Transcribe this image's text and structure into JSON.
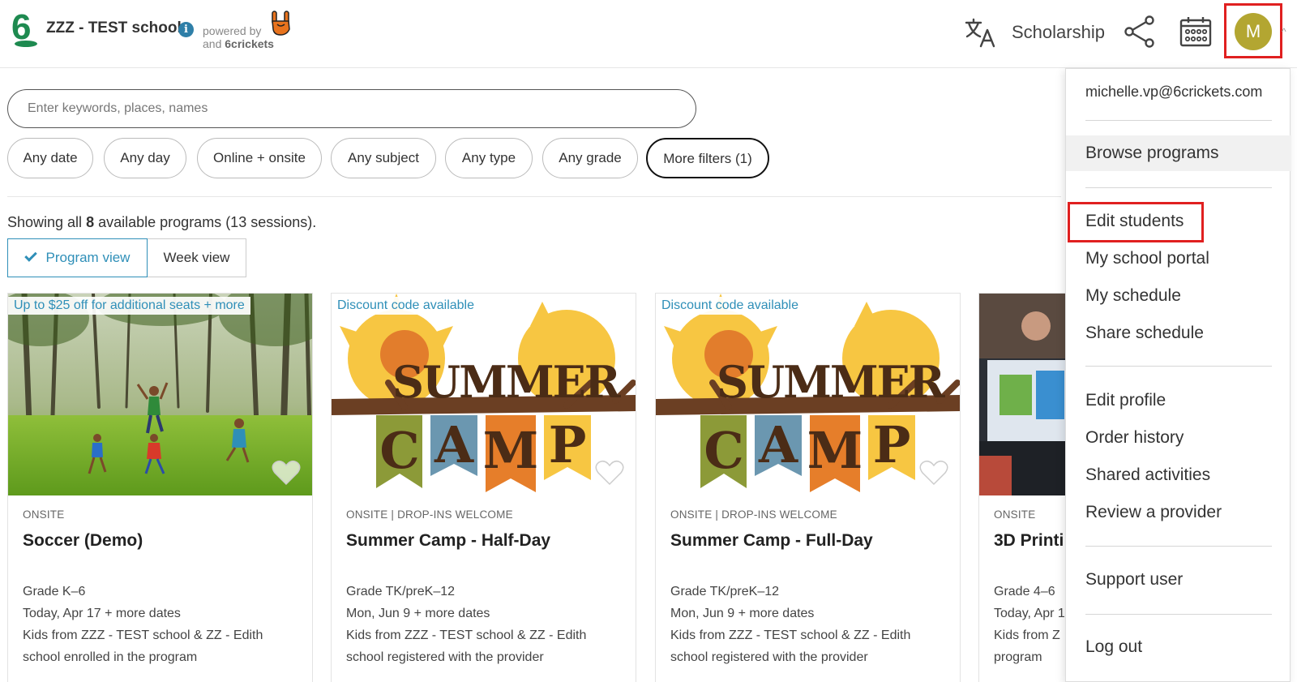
{
  "header": {
    "logo_text": "6",
    "school_name": "ZZZ - TEST school",
    "powered_by": "powered by",
    "powered_and": "and",
    "powered_brand": "6crickets",
    "scholarship_label": "Scholarship",
    "avatar_initial": "M",
    "icons": [
      "translate-icon",
      "share-icon",
      "calendar-icon",
      "info-icon",
      "hand-icon"
    ]
  },
  "search": {
    "placeholder": "Enter keywords, places, names"
  },
  "filters": [
    "Any date",
    "Any day",
    "Online + onsite",
    "Any subject",
    "Any type",
    "Any grade",
    "More filters (1)"
  ],
  "results": {
    "prefix": "Showing all",
    "count": "8",
    "suffix": "available programs (13 sessions)."
  },
  "view_toggle": {
    "program": "Program view",
    "week": "Week view"
  },
  "cards": [
    {
      "badge": "Up to $25 off for additional seats + more",
      "meta": "ONSITE",
      "title": "Soccer (Demo)",
      "grade": "Grade K–6",
      "dates": "Today, Apr 17 + more dates",
      "note1": "Kids from ZZZ - TEST school & ZZ - Edith",
      "note2": "school enrolled in the program"
    },
    {
      "badge": "Discount code available",
      "meta": "ONSITE  |  DROP-INS WELCOME",
      "title": "Summer Camp - Half-Day",
      "grade": "Grade TK/preK–12",
      "dates": "Mon, Jun 9 + more dates",
      "note1": "Kids from ZZZ - TEST school & ZZ - Edith",
      "note2": "school registered with the provider",
      "img_word1": "SUMMER",
      "img_word2": [
        "C",
        "A",
        "M",
        "P"
      ]
    },
    {
      "badge": "Discount code available",
      "meta": "ONSITE  |  DROP-INS WELCOME",
      "title": "Summer Camp - Full-Day",
      "grade": "Grade TK/preK–12",
      "dates": "Mon, Jun 9 + more dates",
      "note1": "Kids from ZZZ - TEST school & ZZ - Edith",
      "note2": "school registered with the provider",
      "img_word1": "SUMMER",
      "img_word2": [
        "C",
        "A",
        "M",
        "P"
      ]
    },
    {
      "badge": "",
      "meta": "ONSITE",
      "title": "3D Printi",
      "grade": "Grade 4–6",
      "dates": "Today, Apr 1",
      "note1": "Kids from Z",
      "note2": "program"
    }
  ],
  "menu": {
    "email": "michelle.vp@6crickets.com",
    "items": [
      "Browse programs",
      "Edit students",
      "My school portal",
      "My schedule",
      "Share schedule",
      "Edit profile",
      "Order history",
      "Shared activities",
      "Review a provider",
      "Support user",
      "Log out"
    ]
  },
  "colors": {
    "accent": "#2f8fb8",
    "highlight_box": "#e02020",
    "avatar": "#b3a631",
    "logo_green": "#1e8a50"
  }
}
